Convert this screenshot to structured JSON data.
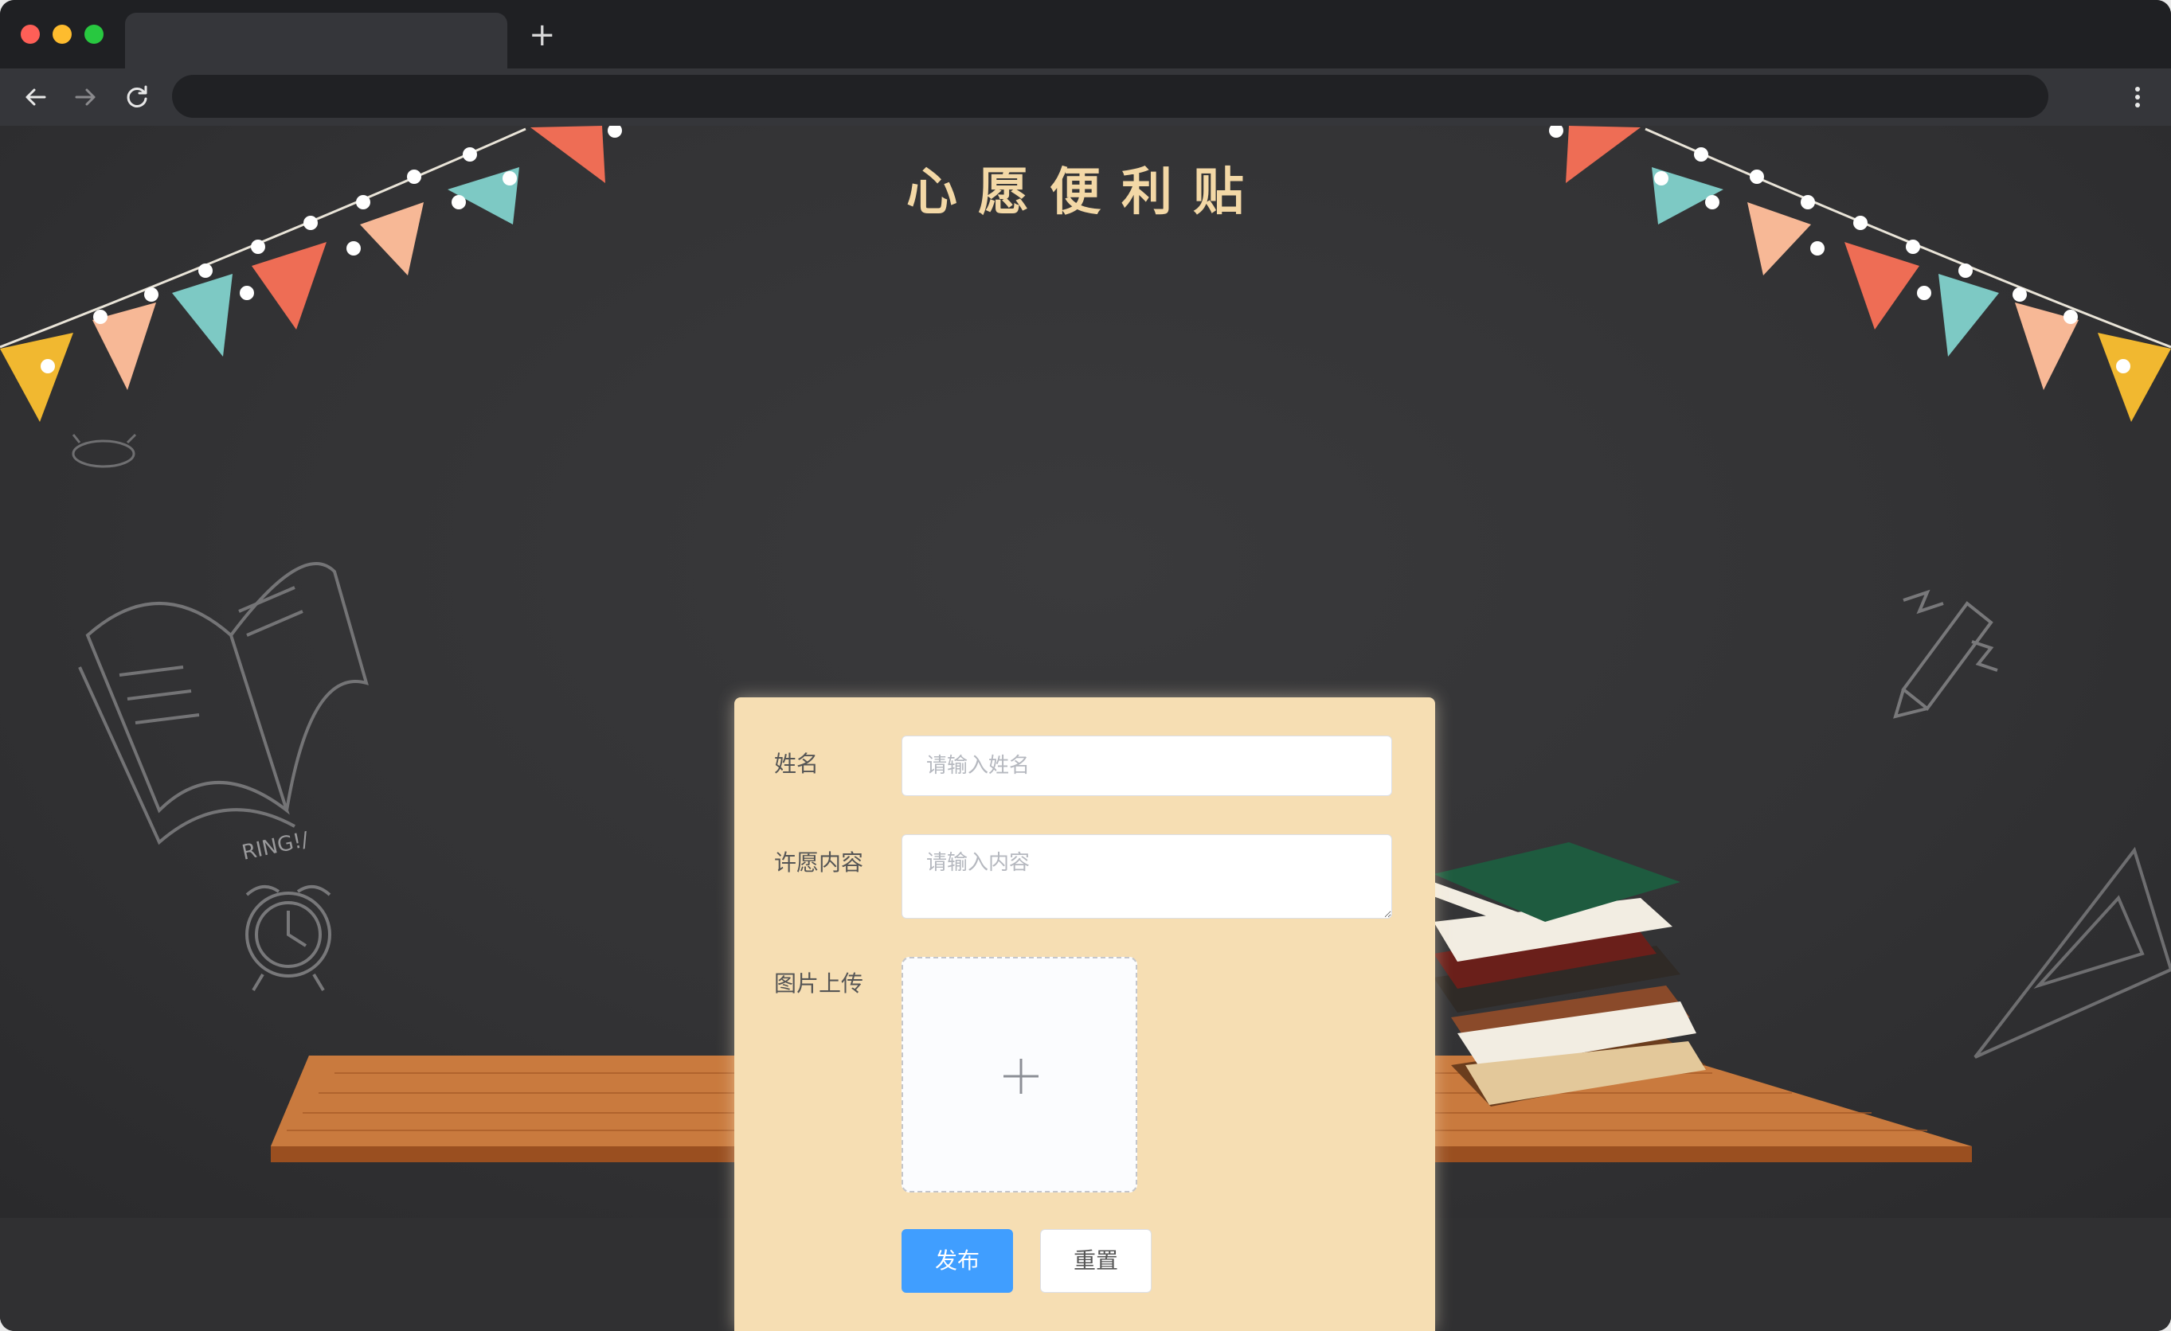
{
  "browser": {
    "tab_title": "",
    "new_tab_label": "+",
    "address": ""
  },
  "page": {
    "title": "心愿便利贴"
  },
  "form": {
    "name_label": "姓名",
    "name_placeholder": "请输入姓名",
    "wish_label": "许愿内容",
    "wish_placeholder": "请输入内容",
    "picture_label": "图片上传",
    "publish_label": "发布",
    "reset_label": "重置"
  },
  "decor": {
    "clock_text": "RING!/"
  },
  "colors": {
    "accent": "#409eff",
    "card": "#f6deb3",
    "title": "#f3d8a6",
    "board": "#333335"
  }
}
